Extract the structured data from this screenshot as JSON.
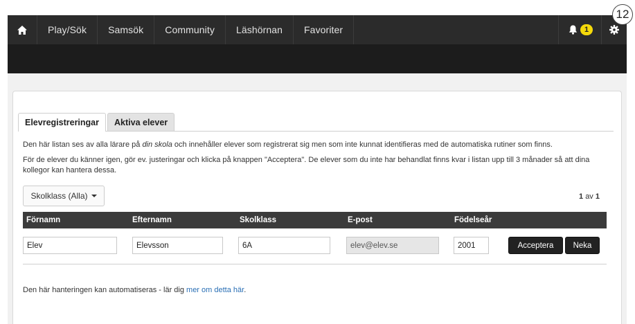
{
  "corner_badge": "12",
  "nav": {
    "items": [
      "Play/Sök",
      "Samsök",
      "Community",
      "Läshörnan",
      "Favoriter"
    ],
    "notification_count": "1",
    "icons": {
      "home": "home-icon",
      "bell": "bell-icon",
      "gear": "gear-icon"
    }
  },
  "tabs": [
    "Elevregistreringar",
    "Aktiva elever"
  ],
  "intro": {
    "line1_before": "Den här listan ses av alla lärare på ",
    "line1_em": "din skola",
    "line1_after": " och innehåller elever som registrerat sig men som inte kunnat identifieras med de automatiska rutiner som finns.",
    "line2": "För de elever du känner igen, gör ev. justeringar och klicka på knappen \"Acceptera\". De elever som du inte har behandlat finns kvar i listan upp till 3 månader så att dina kollegor kan hantera dessa."
  },
  "filter": {
    "label": "Skolklass (Alla)"
  },
  "paging": {
    "current": "1",
    "separator": "av",
    "total": "1"
  },
  "table": {
    "columns": [
      "Förnamn",
      "Efternamn",
      "Skolklass",
      "E-post",
      "Födelseår"
    ],
    "rows": [
      {
        "first_name": "Elev",
        "last_name": "Elevsson",
        "class": "6A",
        "email": "elev@elev.se",
        "birth_year": "2001"
      }
    ],
    "accept_label": "Acceptera",
    "reject_label": "Neka"
  },
  "footer": {
    "text": "Den här hanteringen kan automatiseras - lär dig ",
    "link": "mer om detta här",
    "end": "."
  },
  "colors": {
    "topbar": "#2b2b2b",
    "subbar": "#1c1c1c",
    "badge": "#f5d90a",
    "link": "#2a6fb5",
    "table_header": "#3b3b3b"
  }
}
